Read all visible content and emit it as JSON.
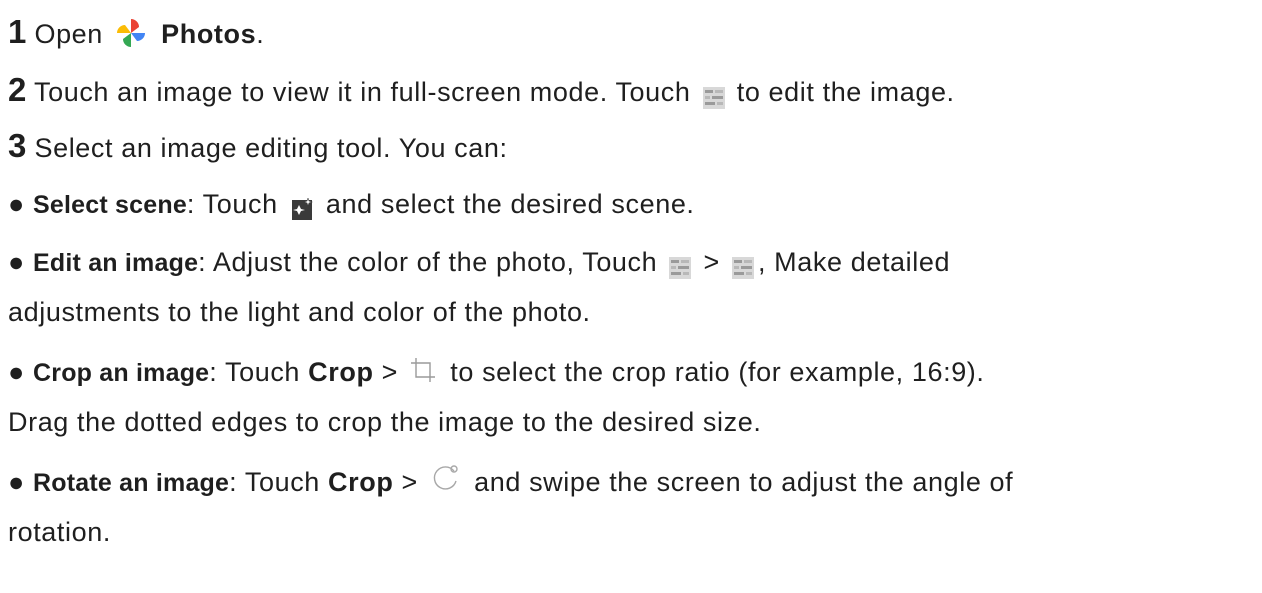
{
  "steps": [
    {
      "number": "1",
      "before": "Open",
      "icon": "photos-pinwheel-icon",
      "bold": "Photos",
      "after": "."
    },
    {
      "number": "2",
      "before": "Touch an image to view it in full-screen mode. Touch",
      "icon": "edit-sliders-icon",
      "after": "to edit the image."
    },
    {
      "number": "3",
      "text": "Select an image editing tool. You can:"
    }
  ],
  "bullets": {
    "select_scene": {
      "label": "Select scene",
      "before": ": Touch",
      "icon": "scene-icon",
      "after": "and select the desired scene."
    },
    "edit_image": {
      "label": "Edit an image",
      "before": ": Adjust the color of the photo, Touch",
      "sep": ">",
      "after": ", Make detailed",
      "line2": "adjustments to the light and color of the photo."
    },
    "crop_image": {
      "label": "Crop an image",
      "before": ": Touch",
      "bold": "Crop",
      "sep": ">",
      "after": "to select the crop ratio (for example, 16:9).",
      "line2": "Drag the dotted edges to crop the image to the desired size."
    },
    "rotate_image": {
      "label": "Rotate an image",
      "before": ": Touch",
      "bold": "Crop",
      "sep": ">",
      "after": "and swipe the screen to adjust the angle of",
      "line2": "rotation."
    }
  },
  "bullet_char": "●"
}
